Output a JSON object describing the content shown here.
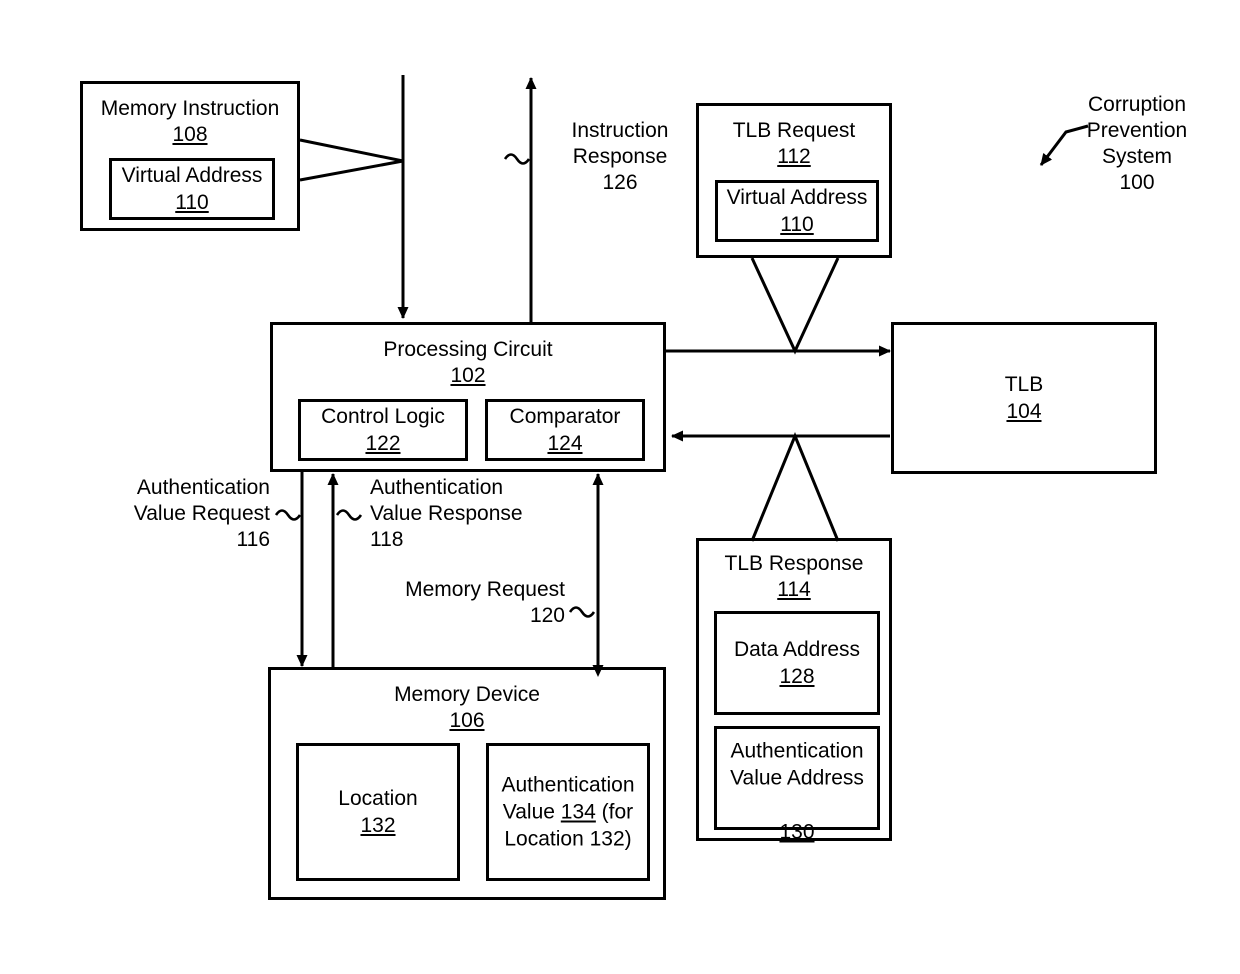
{
  "figure": {
    "title": "Corruption Prevention System",
    "system_label": "Corruption\nPrevention\nSystem\n100"
  },
  "blocks": {
    "memory_instruction": {
      "title": "Memory Instruction",
      "ref": "108",
      "child": {
        "title": "Virtual Address",
        "ref": "110"
      }
    },
    "tlb_request": {
      "title": "TLB Request",
      "ref": "112",
      "child": {
        "title": "Virtual Address",
        "ref": "110"
      }
    },
    "processing_circuit": {
      "title": "Processing Circuit",
      "ref": "102",
      "children": [
        {
          "title": "Control Logic",
          "ref": "122"
        },
        {
          "title": "Comparator",
          "ref": "124"
        }
      ]
    },
    "tlb": {
      "title": "TLB",
      "ref": "104"
    },
    "tlb_response": {
      "title": "TLB Response",
      "ref": "114",
      "children": [
        {
          "title": "Data Address",
          "ref": "128"
        },
        {
          "title": "Authentication\nValue Address",
          "ref": "130"
        }
      ]
    },
    "memory_device": {
      "title": "Memory Device",
      "ref": "106",
      "children": [
        {
          "title": "Location",
          "ref": "132"
        },
        {
          "line1": "Authentication",
          "line2_pre": "Value ",
          "line2_ref": "134",
          "line2_post": " (for",
          "line3": "Location 132)"
        }
      ]
    }
  },
  "flow_labels": {
    "instruction_response": "Instruction\nResponse\n126",
    "authentication_value_request": "Authentication\nValue Request\n116",
    "authentication_value_response": "Authentication\nValue Response\n118",
    "memory_request": "Memory Request\n120"
  },
  "colors": {
    "stroke": "#000000",
    "background": "#ffffff"
  }
}
